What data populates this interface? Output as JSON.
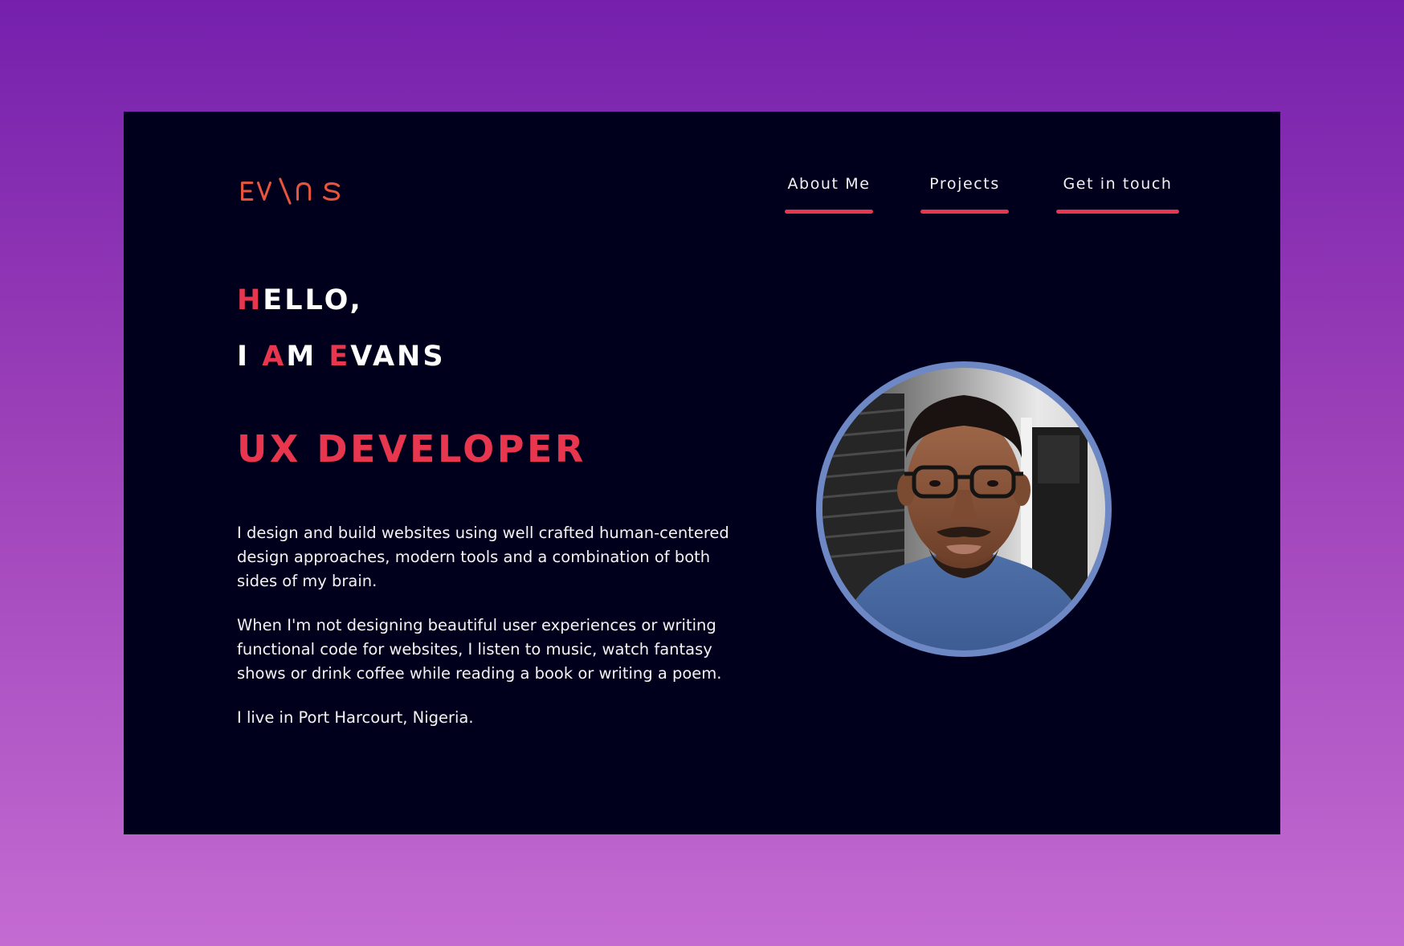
{
  "brand": {
    "logo_text": "EV\\ns",
    "accent_color": "#e8364f"
  },
  "nav": {
    "items": [
      {
        "label": "About Me"
      },
      {
        "label": "Projects"
      },
      {
        "label": "Get in touch"
      }
    ]
  },
  "hero": {
    "greeting_line1": {
      "first": "H",
      "rest": "ELLO,"
    },
    "greeting_line2": {
      "part1": "I ",
      "accent1": "A",
      "part2": "M ",
      "accent2": "E",
      "part3": "VANS"
    },
    "role": "UX DEVELOPER",
    "paragraphs": [
      "I design and build websites using well crafted human-centered design approaches, modern tools and a combination of both sides of my brain.",
      "When I'm not designing beautiful user experiences or writing functional code for websites, I listen to music, watch fantasy shows or drink coffee while reading a book or writing a poem.",
      "I live in Port Harcourt, Nigeria."
    ]
  },
  "profile_photo": {
    "icon": "profile-photo",
    "border_color": "#6d88c4"
  },
  "colors": {
    "page_gradient_top": "#7520ad",
    "page_gradient_bottom": "#c46bd2",
    "card_background": "#00001d",
    "text": "#ffffff"
  }
}
